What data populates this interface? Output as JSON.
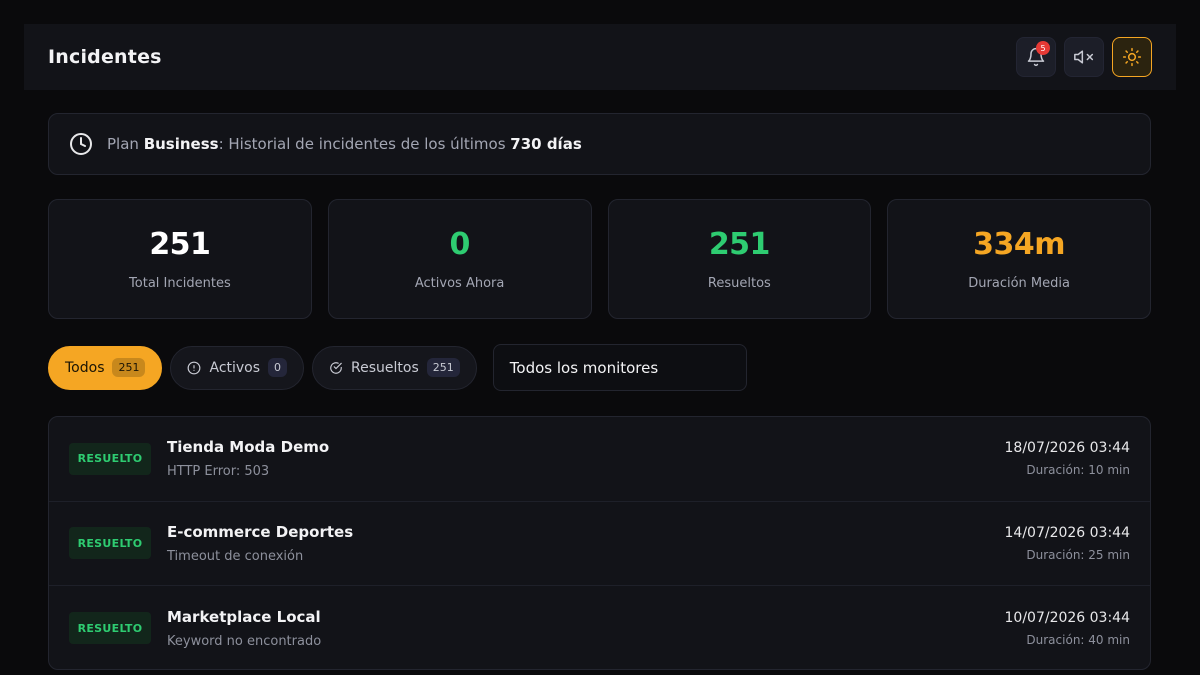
{
  "header": {
    "title": "Incidentes",
    "notifications_count": "5",
    "icons": [
      "bell-icon",
      "mute-icon",
      "sun-icon"
    ]
  },
  "plan": {
    "prefix": "Plan ",
    "name": "Business",
    "middle": ": Historial de incidentes de los últimos ",
    "days": "730 días"
  },
  "stats": [
    {
      "value": "251",
      "label": "Total Incidentes",
      "color": "#ffffff"
    },
    {
      "value": "0",
      "label": "Activos Ahora",
      "color": "#2ecc71"
    },
    {
      "value": "251",
      "label": "Resueltos",
      "color": "#2ecc71"
    },
    {
      "value": "334m",
      "label": "Duración Media",
      "color": "#f5a623"
    }
  ],
  "filters": {
    "all_label": "Todos",
    "all_count": "251",
    "active_label": "Activos",
    "active_count": "0",
    "resolved_label": "Resueltos",
    "resolved_count": "251",
    "monitor_select": "Todos los monitores"
  },
  "incidents": [
    {
      "status": "RESUELTO",
      "title": "Tienda Moda Demo",
      "detail": "HTTP Error: 503",
      "date": "18/07/2026 03:44",
      "duration": "Duración: 10 min"
    },
    {
      "status": "RESUELTO",
      "title": "E-commerce Deportes",
      "detail": "Timeout de conexión",
      "date": "14/07/2026 03:44",
      "duration": "Duración: 25 min"
    },
    {
      "status": "RESUELTO",
      "title": "Marketplace Local",
      "detail": "Keyword no encontrado",
      "date": "10/07/2026 03:44",
      "duration": "Duración: 40 min"
    }
  ]
}
